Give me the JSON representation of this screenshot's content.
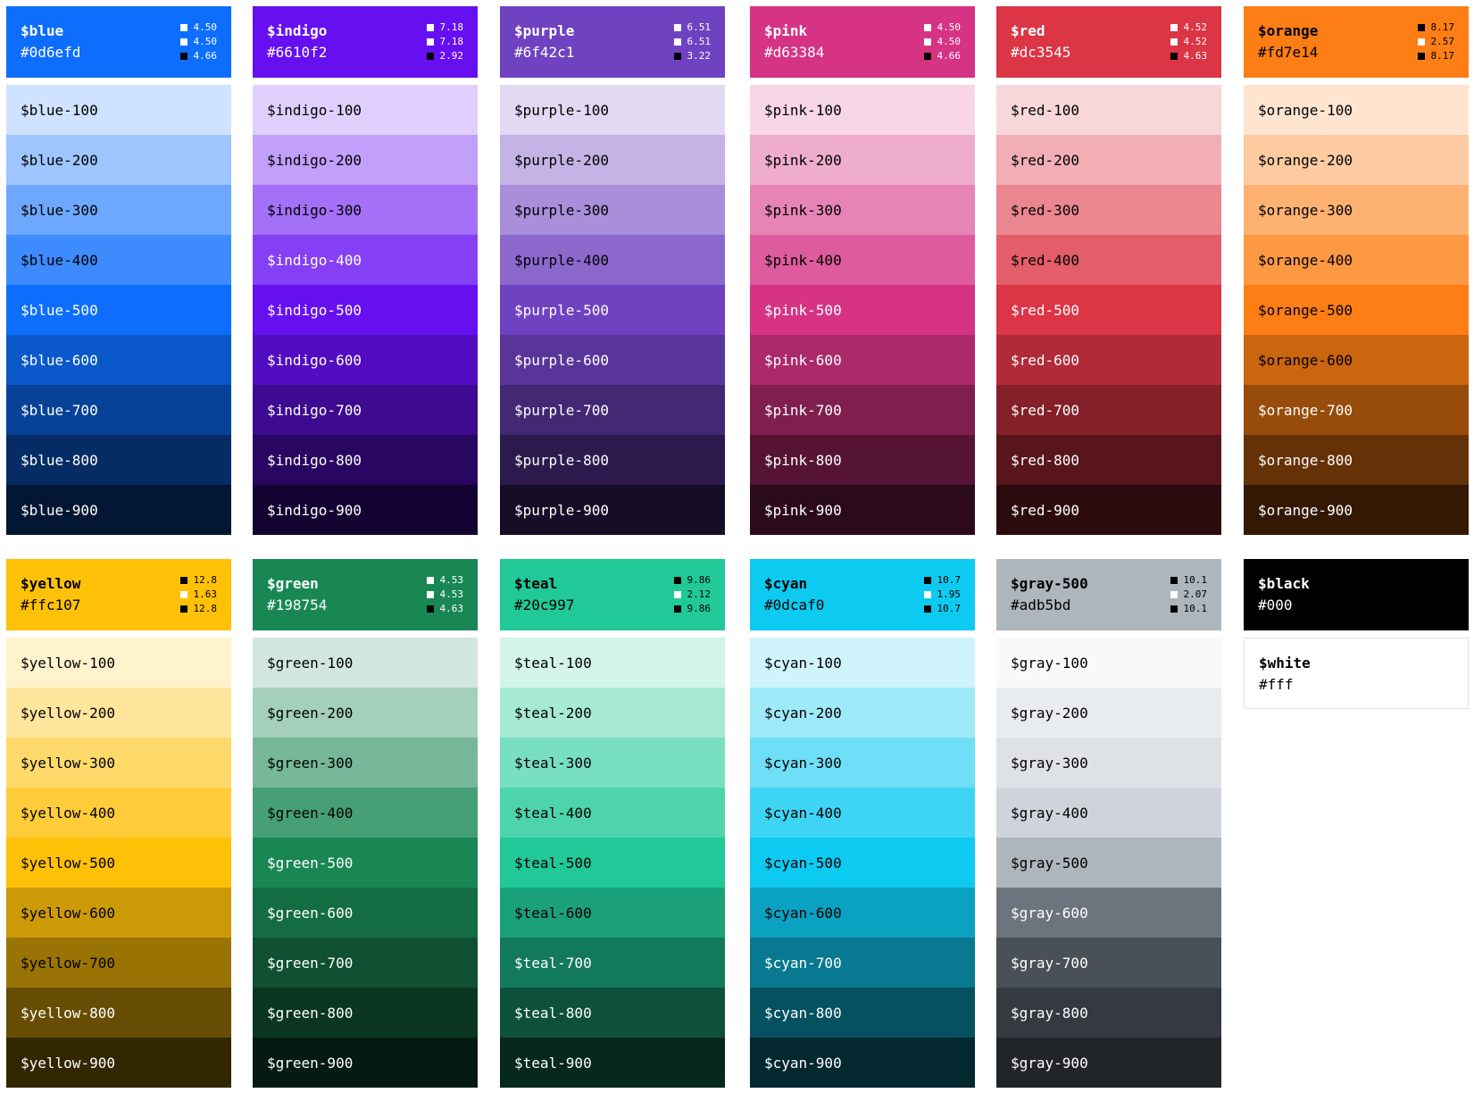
{
  "rows": [
    [
      {
        "name": "$blue",
        "hex": "#0d6efd",
        "bg": "#0d6efd",
        "fg": "#ffffff",
        "contrast": [
          {
            "value": "4.50",
            "color": "#ffffff"
          },
          {
            "value": "4.50",
            "color": "#ffffff"
          },
          {
            "value": "4.66",
            "color": "#000000"
          }
        ],
        "shades": [
          {
            "label": "$blue-100",
            "bg": "#cfe2ff",
            "fg": "#000000"
          },
          {
            "label": "$blue-200",
            "bg": "#9ec5fe",
            "fg": "#000000"
          },
          {
            "label": "$blue-300",
            "bg": "#6ea8fe",
            "fg": "#000000"
          },
          {
            "label": "$blue-400",
            "bg": "#3d8bfd",
            "fg": "#000000"
          },
          {
            "label": "$blue-500",
            "bg": "#0d6efd",
            "fg": "#ffffff"
          },
          {
            "label": "$blue-600",
            "bg": "#0a58ca",
            "fg": "#ffffff"
          },
          {
            "label": "$blue-700",
            "bg": "#084298",
            "fg": "#ffffff"
          },
          {
            "label": "$blue-800",
            "bg": "#052c65",
            "fg": "#ffffff"
          },
          {
            "label": "$blue-900",
            "bg": "#031633",
            "fg": "#ffffff"
          }
        ]
      },
      {
        "name": "$indigo",
        "hex": "#6610f2",
        "bg": "#6610f2",
        "fg": "#ffffff",
        "contrast": [
          {
            "value": "7.18",
            "color": "#ffffff"
          },
          {
            "value": "7.18",
            "color": "#ffffff"
          },
          {
            "value": "2.92",
            "color": "#000000"
          }
        ],
        "shades": [
          {
            "label": "$indigo-100",
            "bg": "#e0cffc",
            "fg": "#000000"
          },
          {
            "label": "$indigo-200",
            "bg": "#c29ffa",
            "fg": "#000000"
          },
          {
            "label": "$indigo-300",
            "bg": "#a370f7",
            "fg": "#000000"
          },
          {
            "label": "$indigo-400",
            "bg": "#8540f5",
            "fg": "#ffffff"
          },
          {
            "label": "$indigo-500",
            "bg": "#6610f2",
            "fg": "#ffffff"
          },
          {
            "label": "$indigo-600",
            "bg": "#520dc2",
            "fg": "#ffffff"
          },
          {
            "label": "$indigo-700",
            "bg": "#3d0a91",
            "fg": "#ffffff"
          },
          {
            "label": "$indigo-800",
            "bg": "#290661",
            "fg": "#ffffff"
          },
          {
            "label": "$indigo-900",
            "bg": "#140330",
            "fg": "#ffffff"
          }
        ]
      },
      {
        "name": "$purple",
        "hex": "#6f42c1",
        "bg": "#6f42c1",
        "fg": "#ffffff",
        "contrast": [
          {
            "value": "6.51",
            "color": "#ffffff"
          },
          {
            "value": "6.51",
            "color": "#ffffff"
          },
          {
            "value": "3.22",
            "color": "#000000"
          }
        ],
        "shades": [
          {
            "label": "$purple-100",
            "bg": "#e2d9f3",
            "fg": "#000000"
          },
          {
            "label": "$purple-200",
            "bg": "#c5b3e6",
            "fg": "#000000"
          },
          {
            "label": "$purple-300",
            "bg": "#a98eda",
            "fg": "#000000"
          },
          {
            "label": "$purple-400",
            "bg": "#8c68cd",
            "fg": "#000000"
          },
          {
            "label": "$purple-500",
            "bg": "#6f42c1",
            "fg": "#ffffff"
          },
          {
            "label": "$purple-600",
            "bg": "#59359a",
            "fg": "#ffffff"
          },
          {
            "label": "$purple-700",
            "bg": "#432874",
            "fg": "#ffffff"
          },
          {
            "label": "$purple-800",
            "bg": "#2c1a4d",
            "fg": "#ffffff"
          },
          {
            "label": "$purple-900",
            "bg": "#160d27",
            "fg": "#ffffff"
          }
        ]
      },
      {
        "name": "$pink",
        "hex": "#d63384",
        "bg": "#d63384",
        "fg": "#ffffff",
        "contrast": [
          {
            "value": "4.50",
            "color": "#ffffff"
          },
          {
            "value": "4.50",
            "color": "#ffffff"
          },
          {
            "value": "4.66",
            "color": "#000000"
          }
        ],
        "shades": [
          {
            "label": "$pink-100",
            "bg": "#f7d6e6",
            "fg": "#000000"
          },
          {
            "label": "$pink-200",
            "bg": "#efadce",
            "fg": "#000000"
          },
          {
            "label": "$pink-300",
            "bg": "#e685b5",
            "fg": "#000000"
          },
          {
            "label": "$pink-400",
            "bg": "#de5c9d",
            "fg": "#000000"
          },
          {
            "label": "$pink-500",
            "bg": "#d63384",
            "fg": "#ffffff"
          },
          {
            "label": "$pink-600",
            "bg": "#ab296a",
            "fg": "#ffffff"
          },
          {
            "label": "$pink-700",
            "bg": "#801f4f",
            "fg": "#ffffff"
          },
          {
            "label": "$pink-800",
            "bg": "#561435",
            "fg": "#ffffff"
          },
          {
            "label": "$pink-900",
            "bg": "#2b0a1a",
            "fg": "#ffffff"
          }
        ]
      },
      {
        "name": "$red",
        "hex": "#dc3545",
        "bg": "#dc3545",
        "fg": "#ffffff",
        "contrast": [
          {
            "value": "4.52",
            "color": "#ffffff"
          },
          {
            "value": "4.52",
            "color": "#ffffff"
          },
          {
            "value": "4.63",
            "color": "#000000"
          }
        ],
        "shades": [
          {
            "label": "$red-100",
            "bg": "#f8d7da",
            "fg": "#000000"
          },
          {
            "label": "$red-200",
            "bg": "#f1aeb5",
            "fg": "#000000"
          },
          {
            "label": "$red-300",
            "bg": "#ea868f",
            "fg": "#000000"
          },
          {
            "label": "$red-400",
            "bg": "#e35d6a",
            "fg": "#000000"
          },
          {
            "label": "$red-500",
            "bg": "#dc3545",
            "fg": "#ffffff"
          },
          {
            "label": "$red-600",
            "bg": "#b02a37",
            "fg": "#ffffff"
          },
          {
            "label": "$red-700",
            "bg": "#842029",
            "fg": "#ffffff"
          },
          {
            "label": "$red-800",
            "bg": "#58151c",
            "fg": "#ffffff"
          },
          {
            "label": "$red-900",
            "bg": "#2c0b0e",
            "fg": "#ffffff"
          }
        ]
      },
      {
        "name": "$orange",
        "hex": "#fd7e14",
        "bg": "#fd7e14",
        "fg": "#000000",
        "contrast": [
          {
            "value": "8.17",
            "color": "#000000"
          },
          {
            "value": "2.57",
            "color": "#ffffff"
          },
          {
            "value": "8.17",
            "color": "#000000"
          }
        ],
        "shades": [
          {
            "label": "$orange-100",
            "bg": "#ffe5d0",
            "fg": "#000000"
          },
          {
            "label": "$orange-200",
            "bg": "#fecba1",
            "fg": "#000000"
          },
          {
            "label": "$orange-300",
            "bg": "#feb272",
            "fg": "#000000"
          },
          {
            "label": "$orange-400",
            "bg": "#fd9843",
            "fg": "#000000"
          },
          {
            "label": "$orange-500",
            "bg": "#fd7e14",
            "fg": "#000000"
          },
          {
            "label": "$orange-600",
            "bg": "#ca6510",
            "fg": "#000000"
          },
          {
            "label": "$orange-700",
            "bg": "#984c0c",
            "fg": "#ffffff"
          },
          {
            "label": "$orange-800",
            "bg": "#653208",
            "fg": "#ffffff"
          },
          {
            "label": "$orange-900",
            "bg": "#331904",
            "fg": "#ffffff"
          }
        ]
      }
    ],
    [
      {
        "name": "$yellow",
        "hex": "#ffc107",
        "bg": "#ffc107",
        "fg": "#000000",
        "contrast": [
          {
            "value": "12.8",
            "color": "#000000"
          },
          {
            "value": "1.63",
            "color": "#ffffff"
          },
          {
            "value": "12.8",
            "color": "#000000"
          }
        ],
        "shades": [
          {
            "label": "$yellow-100",
            "bg": "#fff3cd",
            "fg": "#000000"
          },
          {
            "label": "$yellow-200",
            "bg": "#ffe69c",
            "fg": "#000000"
          },
          {
            "label": "$yellow-300",
            "bg": "#ffda6a",
            "fg": "#000000"
          },
          {
            "label": "$yellow-400",
            "bg": "#ffcd39",
            "fg": "#000000"
          },
          {
            "label": "$yellow-500",
            "bg": "#ffc107",
            "fg": "#000000"
          },
          {
            "label": "$yellow-600",
            "bg": "#cc9a06",
            "fg": "#000000"
          },
          {
            "label": "$yellow-700",
            "bg": "#997404",
            "fg": "#000000"
          },
          {
            "label": "$yellow-800",
            "bg": "#664d03",
            "fg": "#ffffff"
          },
          {
            "label": "$yellow-900",
            "bg": "#332701",
            "fg": "#ffffff"
          }
        ]
      },
      {
        "name": "$green",
        "hex": "#198754",
        "bg": "#198754",
        "fg": "#ffffff",
        "contrast": [
          {
            "value": "4.53",
            "color": "#ffffff"
          },
          {
            "value": "4.53",
            "color": "#ffffff"
          },
          {
            "value": "4.63",
            "color": "#000000"
          }
        ],
        "shades": [
          {
            "label": "$green-100",
            "bg": "#d1e7dd",
            "fg": "#000000"
          },
          {
            "label": "$green-200",
            "bg": "#a3cfbb",
            "fg": "#000000"
          },
          {
            "label": "$green-300",
            "bg": "#75b798",
            "fg": "#000000"
          },
          {
            "label": "$green-400",
            "bg": "#479f76",
            "fg": "#000000"
          },
          {
            "label": "$green-500",
            "bg": "#198754",
            "fg": "#ffffff"
          },
          {
            "label": "$green-600",
            "bg": "#146c43",
            "fg": "#ffffff"
          },
          {
            "label": "$green-700",
            "bg": "#0f5132",
            "fg": "#ffffff"
          },
          {
            "label": "$green-800",
            "bg": "#0a3622",
            "fg": "#ffffff"
          },
          {
            "label": "$green-900",
            "bg": "#051b11",
            "fg": "#ffffff"
          }
        ]
      },
      {
        "name": "$teal",
        "hex": "#20c997",
        "bg": "#20c997",
        "fg": "#000000",
        "contrast": [
          {
            "value": "9.86",
            "color": "#000000"
          },
          {
            "value": "2.12",
            "color": "#ffffff"
          },
          {
            "value": "9.86",
            "color": "#000000"
          }
        ],
        "shades": [
          {
            "label": "$teal-100",
            "bg": "#d2f4ea",
            "fg": "#000000"
          },
          {
            "label": "$teal-200",
            "bg": "#a6e9d5",
            "fg": "#000000"
          },
          {
            "label": "$teal-300",
            "bg": "#79dfc1",
            "fg": "#000000"
          },
          {
            "label": "$teal-400",
            "bg": "#4dd4ac",
            "fg": "#000000"
          },
          {
            "label": "$teal-500",
            "bg": "#20c997",
            "fg": "#000000"
          },
          {
            "label": "$teal-600",
            "bg": "#1aa179",
            "fg": "#000000"
          },
          {
            "label": "$teal-700",
            "bg": "#13795b",
            "fg": "#ffffff"
          },
          {
            "label": "$teal-800",
            "bg": "#0d503c",
            "fg": "#ffffff"
          },
          {
            "label": "$teal-900",
            "bg": "#06281e",
            "fg": "#ffffff"
          }
        ]
      },
      {
        "name": "$cyan",
        "hex": "#0dcaf0",
        "bg": "#0dcaf0",
        "fg": "#000000",
        "contrast": [
          {
            "value": "10.7",
            "color": "#000000"
          },
          {
            "value": "1.95",
            "color": "#ffffff"
          },
          {
            "value": "10.7",
            "color": "#000000"
          }
        ],
        "shades": [
          {
            "label": "$cyan-100",
            "bg": "#cff4fc",
            "fg": "#000000"
          },
          {
            "label": "$cyan-200",
            "bg": "#9eeaf9",
            "fg": "#000000"
          },
          {
            "label": "$cyan-300",
            "bg": "#6edff6",
            "fg": "#000000"
          },
          {
            "label": "$cyan-400",
            "bg": "#3dd5f3",
            "fg": "#000000"
          },
          {
            "label": "$cyan-500",
            "bg": "#0dcaf0",
            "fg": "#000000"
          },
          {
            "label": "$cyan-600",
            "bg": "#0aa2c0",
            "fg": "#000000"
          },
          {
            "label": "$cyan-700",
            "bg": "#087990",
            "fg": "#ffffff"
          },
          {
            "label": "$cyan-800",
            "bg": "#055160",
            "fg": "#ffffff"
          },
          {
            "label": "$cyan-900",
            "bg": "#032830",
            "fg": "#ffffff"
          }
        ]
      },
      {
        "name": "$gray-500",
        "hex": "#adb5bd",
        "bg": "#adb5bd",
        "fg": "#000000",
        "contrast": [
          {
            "value": "10.1",
            "color": "#000000"
          },
          {
            "value": "2.07",
            "color": "#ffffff"
          },
          {
            "value": "10.1",
            "color": "#000000"
          }
        ],
        "shades": [
          {
            "label": "$gray-100",
            "bg": "#f8f9fa",
            "fg": "#000000"
          },
          {
            "label": "$gray-200",
            "bg": "#e9ecef",
            "fg": "#000000"
          },
          {
            "label": "$gray-300",
            "bg": "#dee2e6",
            "fg": "#000000"
          },
          {
            "label": "$gray-400",
            "bg": "#ced4da",
            "fg": "#000000"
          },
          {
            "label": "$gray-500",
            "bg": "#adb5bd",
            "fg": "#000000"
          },
          {
            "label": "$gray-600",
            "bg": "#6c757d",
            "fg": "#ffffff"
          },
          {
            "label": "$gray-700",
            "bg": "#495057",
            "fg": "#ffffff"
          },
          {
            "label": "$gray-800",
            "bg": "#343a40",
            "fg": "#ffffff"
          },
          {
            "label": "$gray-900",
            "bg": "#212529",
            "fg": "#ffffff"
          }
        ]
      }
    ]
  ],
  "black": {
    "name": "$black",
    "hex": "#000"
  },
  "white": {
    "name": "$white",
    "hex": "#fff"
  }
}
